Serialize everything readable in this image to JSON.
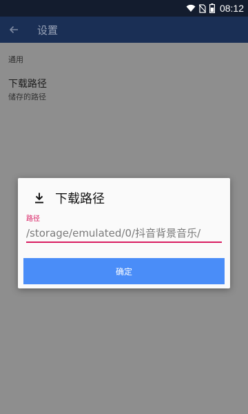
{
  "status_bar": {
    "time": "08:12",
    "icons": [
      "wifi-icon",
      "no-sim-icon",
      "battery-icon"
    ]
  },
  "app_bar": {
    "title": "设置",
    "back_icon": "arrow-left-icon"
  },
  "settings": {
    "section_header": "通用",
    "download_path": {
      "title": "下载路径",
      "summary": "储存的路径"
    }
  },
  "dialog": {
    "title": "下载路径",
    "icon": "download-icon",
    "field_label": "路径",
    "path_value": "/storage/emulated/0/抖音背景音乐/",
    "confirm_label": "确定"
  },
  "colors": {
    "status_bar": "#131c2e",
    "app_bar_dimmed": "#1a2f55",
    "scrim_background": "#8e8e8e",
    "accent_pink": "#d81b60",
    "confirm_button": "#4a8df8"
  }
}
